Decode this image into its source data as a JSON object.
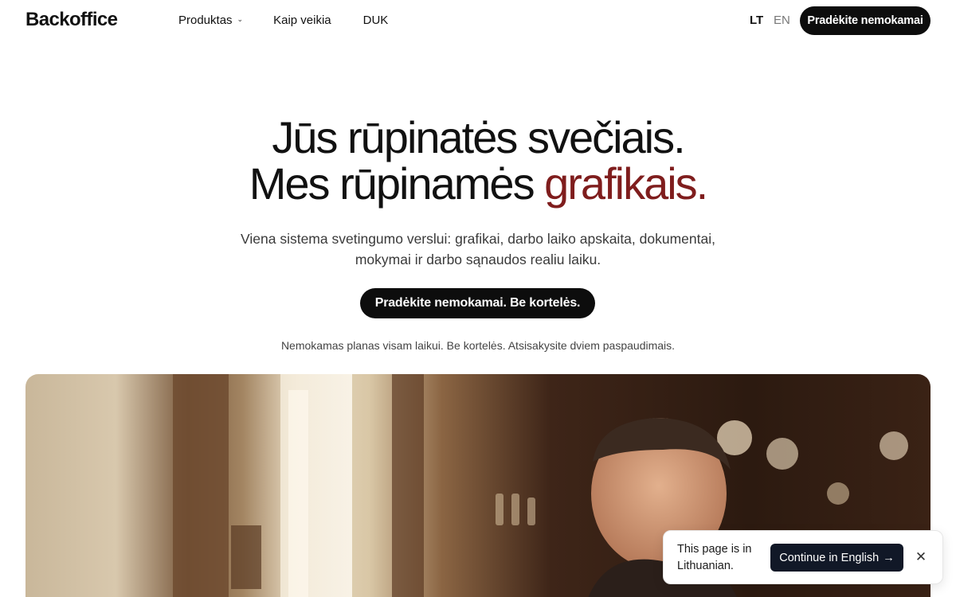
{
  "header": {
    "logo": "Backoffice",
    "nav": [
      {
        "label": "Produktas",
        "icon": "chevron-down-icon"
      },
      {
        "label": "Kaip veikia"
      },
      {
        "label": "DUK"
      }
    ],
    "languages": {
      "active": "LT",
      "other": "EN"
    },
    "cta_label": "Pradėkite nemokamai"
  },
  "hero": {
    "title_line1": "Jūs rūpinatės svečiais.",
    "title_line2_prefix": "Mes rūpinamės ",
    "title_line2_accent": "grafikais.",
    "subtitle": "Viena sistema svetingumo verslui: grafikai, darbo laiko apskaita, dokumentai, mokymai ir darbo sąnaudos realiu laiku.",
    "cta_label": "Pradėkite nemokamai. Be kortelės.",
    "note": "Nemokamas planas visam laikui. Be kortelės. Atsisakysite dviem paspaudimais."
  },
  "language_popup": {
    "message": "This page is in Lithuanian.",
    "button_label": "Continue in English",
    "button_icon": "arrow-right-icon",
    "close_icon": "close-icon"
  },
  "colors": {
    "accent": "#7f1d1d",
    "button_dark": "#0d0d0d",
    "popup_button": "#111827"
  }
}
